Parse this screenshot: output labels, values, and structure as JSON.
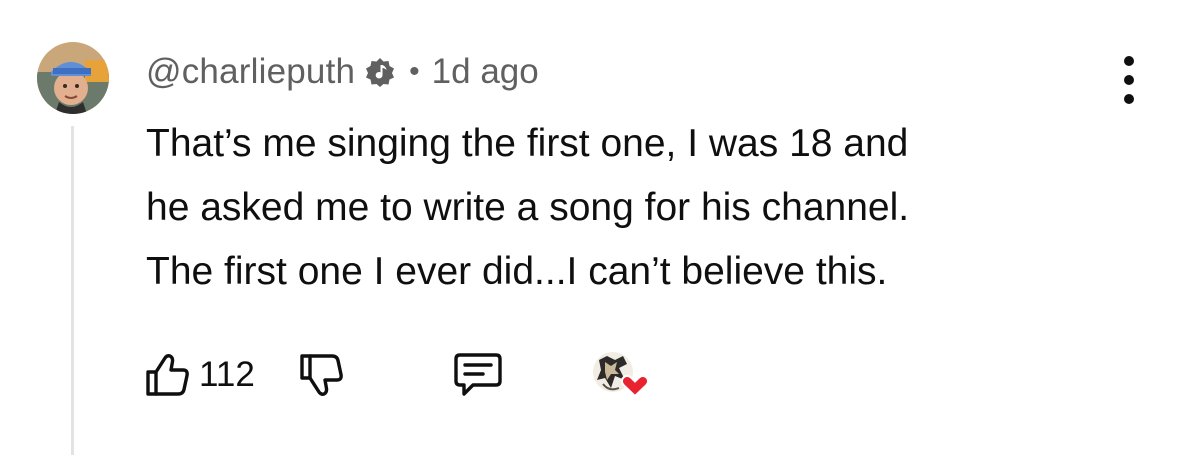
{
  "comment": {
    "author_handle": "@charlieputh",
    "verified_icon": "music-note-verified-icon",
    "separator": "•",
    "timestamp": "1d ago",
    "text_lines": [
      "That’s me singing the first one, I was 18 and",
      "he asked me to write a song for his channel.",
      "The first one I ever did...I can’t believe this."
    ],
    "like_count": "112"
  },
  "icons": {
    "like": "thumbs-up-icon",
    "dislike": "thumbs-down-icon",
    "reply": "reply-comment-icon",
    "more": "more-vertical-icon",
    "creator_heart": "creator-heart-icon"
  },
  "colors": {
    "text_primary": "#0f0f0f",
    "text_secondary": "#606060",
    "heart": "#e8222f",
    "thread_line": "#e3e3e3"
  }
}
